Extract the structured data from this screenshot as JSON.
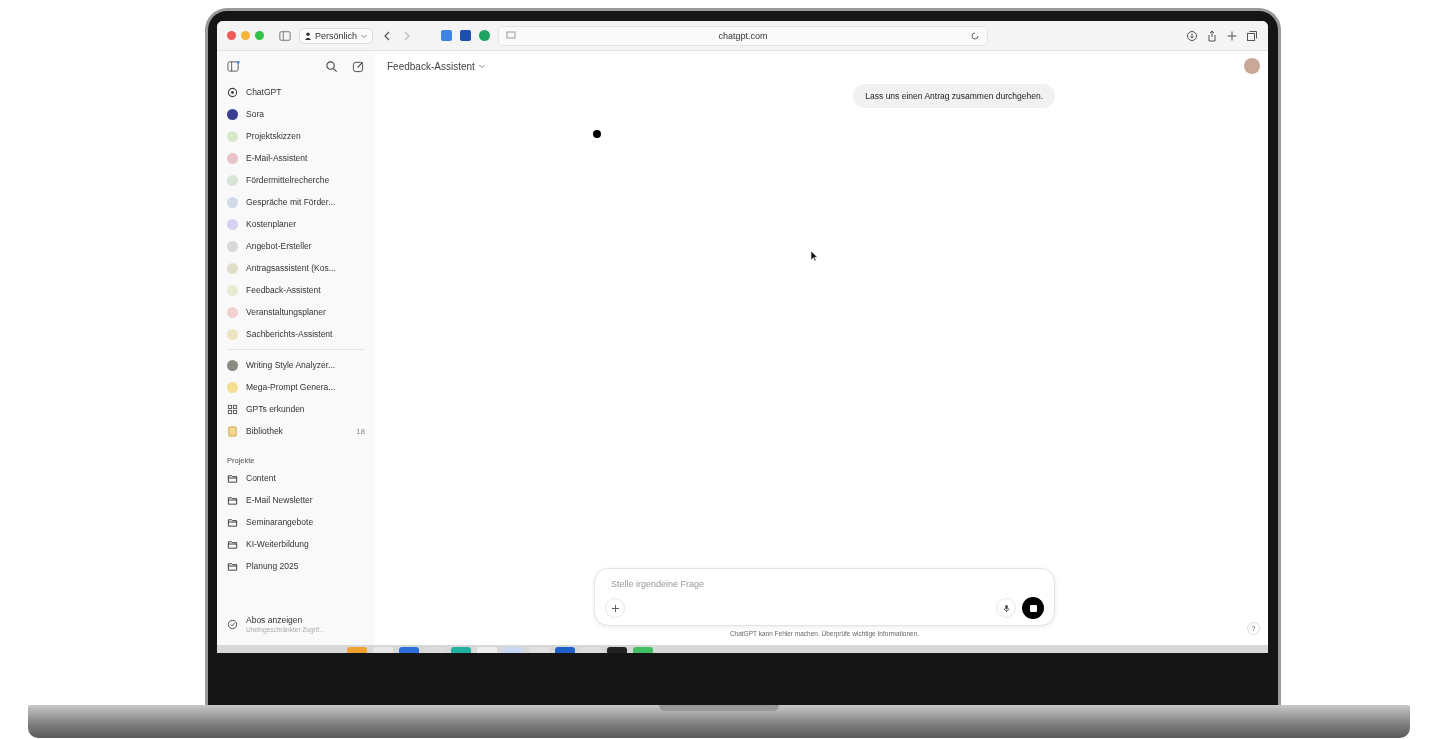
{
  "browser": {
    "profile": "Persönlich",
    "url": "chatgpt.com"
  },
  "sidebar": {
    "gpts": [
      {
        "label": "ChatGPT",
        "kind": "logo"
      },
      {
        "label": "Sora",
        "kind": "avatar",
        "color": "#3b3f8f"
      },
      {
        "label": "Projektskizzen",
        "kind": "avatar",
        "color": "#d9e8c8"
      },
      {
        "label": "E-Mail-Assistent",
        "kind": "avatar",
        "color": "#e8c4c8"
      },
      {
        "label": "Fördermittelrecherche",
        "kind": "avatar",
        "color": "#d6e6d6"
      },
      {
        "label": "Gespräche mit Förder...",
        "kind": "avatar",
        "color": "#cfdbe6"
      },
      {
        "label": "Kostenplaner",
        "kind": "avatar",
        "color": "#d8d0f0"
      },
      {
        "label": "Angebot-Ersteller",
        "kind": "avatar",
        "color": "#d8d8d8"
      },
      {
        "label": "Antragsassistent (Kos...",
        "kind": "avatar",
        "color": "#e0e0c8"
      },
      {
        "label": "Feedback-Assistent",
        "kind": "avatar",
        "color": "#e6ecd0"
      },
      {
        "label": "Veranstaltungsplaner",
        "kind": "avatar",
        "color": "#f0d0d0"
      },
      {
        "label": "Sachberichts-Assistent",
        "kind": "avatar",
        "color": "#ece6c0"
      }
    ],
    "more": [
      {
        "label": "Writing Style Analyzer...",
        "kind": "avatar",
        "color": "#8a8a80"
      },
      {
        "label": "Mega-Prompt Genera...",
        "kind": "avatar",
        "color": "#f4dc90"
      },
      {
        "label": "GPTs erkunden",
        "kind": "grid"
      },
      {
        "label": "Bibliothek",
        "kind": "library",
        "count": "18"
      }
    ],
    "projects_heading": "Projekte",
    "projects": [
      "Content",
      "E-Mail Newsletter",
      "Seminarangebote",
      "KI-Weiterbildung",
      "Planung 2025"
    ],
    "upgrade": {
      "title": "Abos anzeigen",
      "subtitle": "Uneingeschränkter Zugrif..."
    }
  },
  "chat": {
    "title": "Feedback-Assistent",
    "messages": [
      "Lass uns einen Antrag zusammen durchgehen."
    ],
    "composer": {
      "placeholder": "Stelle irgendeine Frage"
    },
    "disclaimer": "ChatGPT kann Fehler machen. Überprüfe wichtige Informationen.",
    "help": "?"
  }
}
